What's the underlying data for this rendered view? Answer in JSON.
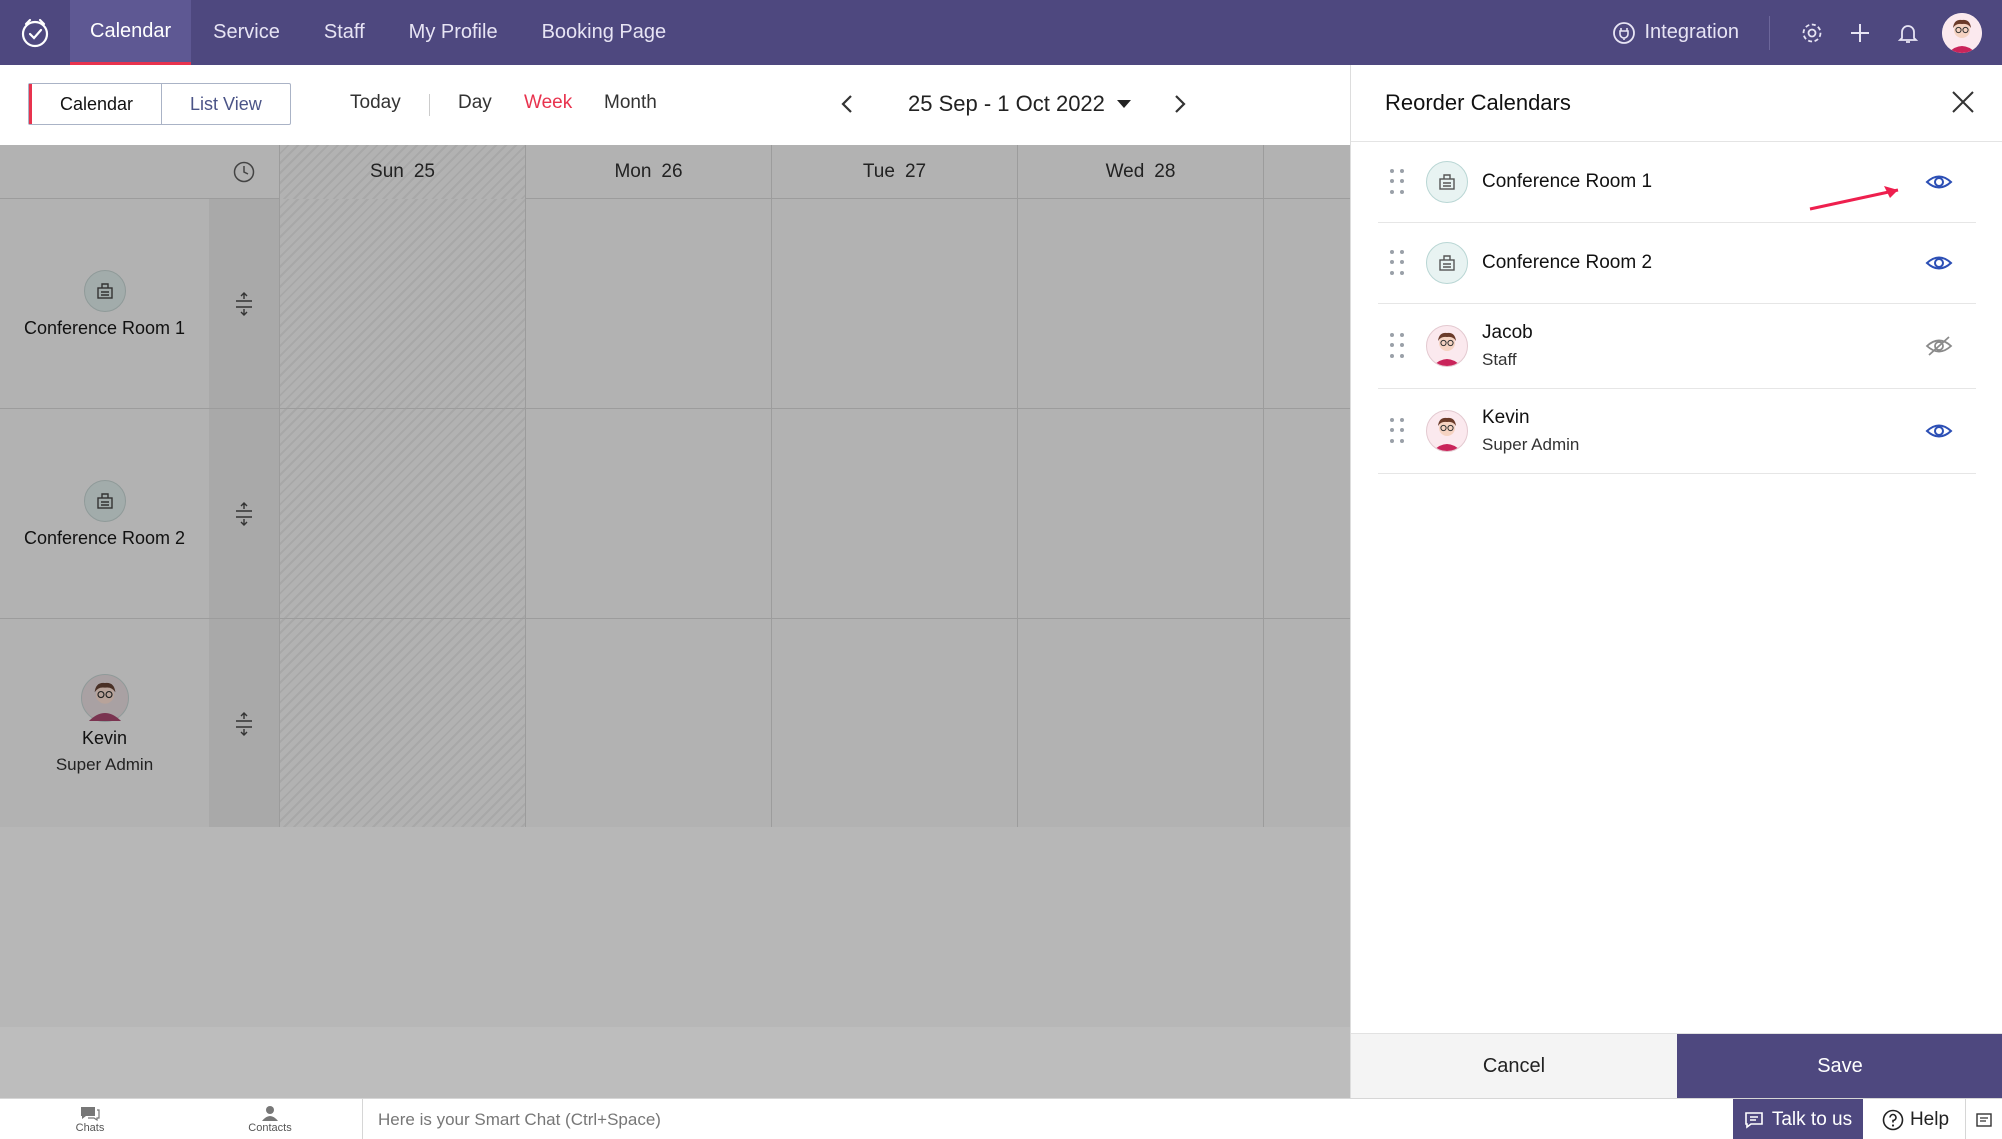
{
  "nav": {
    "items": [
      {
        "label": "Calendar",
        "active": true
      },
      {
        "label": "Service",
        "active": false
      },
      {
        "label": "Staff",
        "active": false
      },
      {
        "label": "My Profile",
        "active": false
      },
      {
        "label": "Booking Page",
        "active": false
      }
    ],
    "integration_label": "Integration",
    "icons": [
      "logo-icon",
      "integration-icon",
      "settings-icon",
      "plus-icon",
      "bell-icon",
      "avatar"
    ]
  },
  "toolbar": {
    "view_tabs": [
      "Calendar",
      "List View"
    ],
    "today_label": "Today",
    "ranges": [
      {
        "label": "Day",
        "active": false
      },
      {
        "label": "Week",
        "active": true
      },
      {
        "label": "Month",
        "active": false
      }
    ],
    "date_range": "25 Sep - 1 Oct 2022"
  },
  "calendar": {
    "days": [
      {
        "name": "Sun",
        "num": "25"
      },
      {
        "name": "Mon",
        "num": "26"
      },
      {
        "name": "Tue",
        "num": "27"
      },
      {
        "name": "Wed",
        "num": "28"
      }
    ],
    "resources": [
      {
        "name": "Conference Room 1",
        "sub": "",
        "type": "room"
      },
      {
        "name": "Conference Room 2",
        "sub": "",
        "type": "room"
      },
      {
        "name": "Kevin",
        "sub": "Super Admin",
        "type": "person"
      }
    ]
  },
  "panel": {
    "title": "Reorder Calendars",
    "items": [
      {
        "name": "Conference Room 1",
        "sub": "",
        "type": "room",
        "visible": true
      },
      {
        "name": "Conference Room 2",
        "sub": "",
        "type": "room",
        "visible": true
      },
      {
        "name": "Jacob",
        "sub": "Staff",
        "type": "person",
        "visible": false
      },
      {
        "name": "Kevin",
        "sub": "Super Admin",
        "type": "person",
        "visible": true
      }
    ],
    "cancel_label": "Cancel",
    "save_label": "Save"
  },
  "bottom": {
    "chats_label": "Chats",
    "contacts_label": "Contacts",
    "smart_chat_placeholder": "Here is your Smart Chat (Ctrl+Space)",
    "talk_label": "Talk to us",
    "help_label": "Help"
  },
  "colors": {
    "brand": "#4e487f",
    "accent": "#e8334e",
    "eye": "#2c4fb5"
  }
}
